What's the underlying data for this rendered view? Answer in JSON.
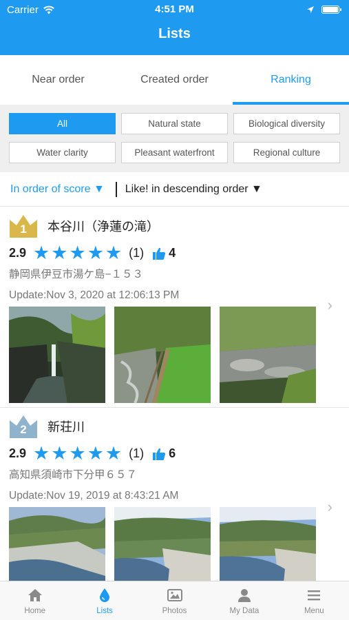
{
  "status": {
    "carrier": "Carrier",
    "time": "4:51 PM"
  },
  "header": {
    "title": "Lists"
  },
  "tabs": [
    {
      "label": "Near order",
      "active": false
    },
    {
      "label": "Created order",
      "active": false
    },
    {
      "label": "Ranking",
      "active": true
    }
  ],
  "filters": [
    {
      "label": "All",
      "active": true
    },
    {
      "label": "Natural state",
      "active": false
    },
    {
      "label": "Biological diversity",
      "active": false
    },
    {
      "label": "Water clarity",
      "active": false
    },
    {
      "label": "Pleasant waterfront",
      "active": false
    },
    {
      "label": "Regional culture",
      "active": false
    }
  ],
  "sort": {
    "score_label": "In order of score ▼",
    "like_label": "Like! in descending order ▼"
  },
  "items": [
    {
      "rank": "1",
      "name": "本谷川（浄蓮の滝）",
      "score": "2.9",
      "stars": 5,
      "count": "(1)",
      "likes": "4",
      "address": "静岡県伊豆市湯ケ島−１５３",
      "update": "Update:Nov 3, 2020 at 12:06:13 PM",
      "crown_color": "#d9b74a"
    },
    {
      "rank": "2",
      "name": "新荘川",
      "score": "2.9",
      "stars": 5,
      "count": "(1)",
      "likes": "6",
      "address": "高知県須崎市下分甲６５７",
      "update": "Update:Nov 19, 2019 at 8:43:21 AM",
      "crown_color": "#8fb3cc"
    }
  ],
  "nav": [
    {
      "label": "Home",
      "icon": "home-icon",
      "active": false
    },
    {
      "label": "Lists",
      "icon": "drop-icon",
      "active": true
    },
    {
      "label": "Photos",
      "icon": "photos-icon",
      "active": false
    },
    {
      "label": "My Data",
      "icon": "person-icon",
      "active": false
    },
    {
      "label": "Menu",
      "icon": "menu-icon",
      "active": false
    }
  ],
  "colors": {
    "accent": "#1e9bf0",
    "gold": "#d9b74a",
    "silver": "#8fb3cc"
  }
}
